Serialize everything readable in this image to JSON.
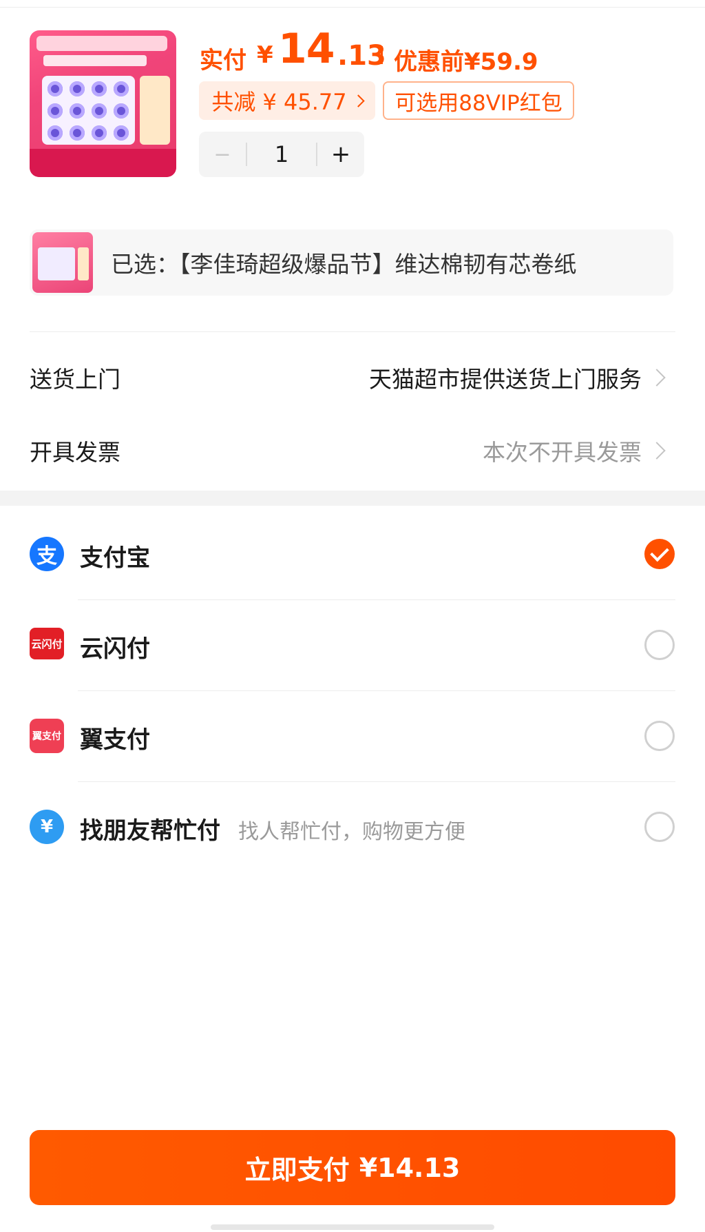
{
  "product": {
    "price_label": "实付",
    "currency": "¥",
    "price_integer": "14",
    "price_decimal": ".13",
    "original_price": "优惠前¥59.9",
    "discount_text": "共减 ¥ 45.77",
    "vip_text": "可选用88VIP红包",
    "quantity": "1",
    "minus_symbol": "−",
    "plus_symbol": "+"
  },
  "selected": {
    "text": "已选：【李佳琦超级爆品节】维达棉韧有芯卷纸"
  },
  "delivery": {
    "label": "送货上门",
    "value": "天猫超市提供送货上门服务"
  },
  "invoice": {
    "label": "开具发票",
    "value": "本次不开具发票"
  },
  "payments": [
    {
      "name": "支付宝",
      "subtitle": "",
      "icon": "alipay-icon",
      "icon_color": "#1677ff",
      "selected": true
    },
    {
      "name": "云闪付",
      "subtitle": "",
      "icon": "unionpay-icon",
      "icon_color": "#e21f26",
      "selected": false
    },
    {
      "name": "翼支付",
      "subtitle": "",
      "icon": "bestpay-icon",
      "icon_color": "#ef3f54",
      "selected": false
    },
    {
      "name": "找朋友帮忙付",
      "subtitle": "找人帮忙付，购物更方便",
      "icon": "friend-pay-icon",
      "icon_color": "#2e9cf2",
      "selected": false
    }
  ],
  "pay_button": {
    "label": "立即支付",
    "amount": "¥14.13"
  },
  "colors": {
    "accent": "#ff5000",
    "gray_text": "#9a9a9a"
  }
}
